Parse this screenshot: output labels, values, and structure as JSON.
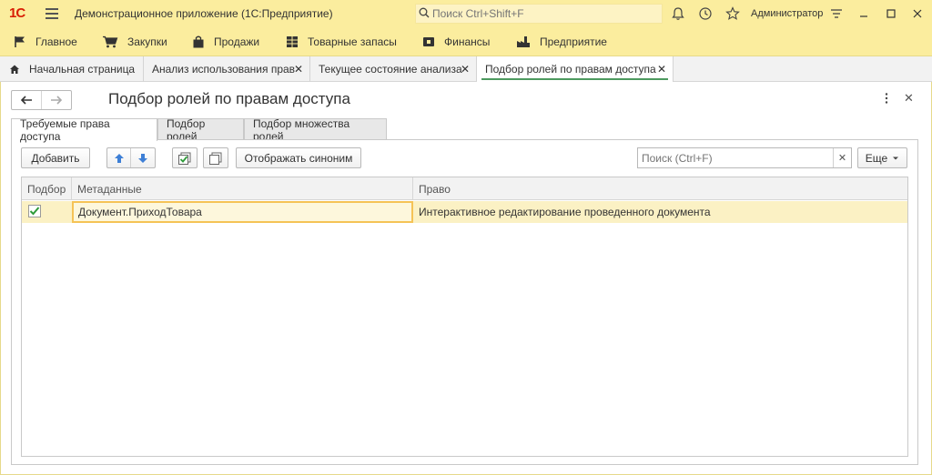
{
  "app": {
    "logo": "1С",
    "title": "Демонстрационное приложение  (1С:Предприятие)",
    "search_placeholder": "Поиск Ctrl+Shift+F",
    "user": "Администратор"
  },
  "sections": [
    {
      "label": "Главное",
      "icon": "flag-icon"
    },
    {
      "label": "Закупки",
      "icon": "cart-icon"
    },
    {
      "label": "Продажи",
      "icon": "bag-icon"
    },
    {
      "label": "Товарные запасы",
      "icon": "grid-icon"
    },
    {
      "label": "Финансы",
      "icon": "money-icon"
    },
    {
      "label": "Предприятие",
      "icon": "factory-icon"
    }
  ],
  "open_tabs": [
    {
      "label": "Начальная страница",
      "icon": "home-icon"
    },
    {
      "label": "Анализ использования прав"
    },
    {
      "label": "Текущее состояние анализа"
    },
    {
      "label": "Подбор ролей по правам доступа",
      "active": true
    }
  ],
  "form": {
    "title": "Подбор ролей по правам доступа",
    "tabs": [
      {
        "label": "Требуемые права доступа",
        "active": true
      },
      {
        "label": "Подбор ролей"
      },
      {
        "label": "Подбор множества ролей"
      }
    ],
    "toolbar": {
      "add_label": "Добавить",
      "synonym_label": "Отображать синоним",
      "find_placeholder": "Поиск (Ctrl+F)",
      "more_label": "Еще"
    },
    "table": {
      "columns": [
        "Подбор",
        "Метаданные",
        "Право"
      ],
      "rows": [
        {
          "selected": true,
          "metadata": "Документ.ПриходТовара",
          "right": "Интерактивное редактирование проведенного документа"
        }
      ]
    }
  },
  "colors": {
    "titlebar_bg": "#fbed9e",
    "selected_row": "#fbf1c4",
    "focus_border": "#f5c356",
    "active_tab_underline": "#4d9a5f",
    "logo": "#d81e05"
  }
}
